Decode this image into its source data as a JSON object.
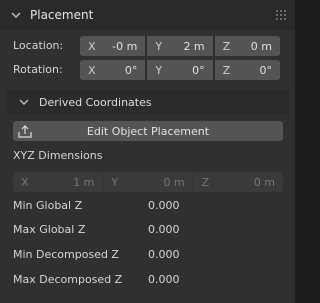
{
  "panel": {
    "title": "Placement"
  },
  "location": {
    "label": "Location:",
    "x_axis": "X",
    "x_value": "-0 m",
    "y_axis": "Y",
    "y_value": "2 m",
    "z_axis": "Z",
    "z_value": "0 m"
  },
  "rotation": {
    "label": "Rotation:",
    "x_axis": "X",
    "x_value": "0°",
    "y_axis": "Y",
    "y_value": "0°",
    "z_axis": "Z",
    "z_value": "0°"
  },
  "derived": {
    "title": "Derived Coordinates"
  },
  "edit_button": {
    "label": "Edit Object Placement"
  },
  "dimensions": {
    "label": "XYZ Dimensions",
    "x_axis": "X",
    "x_value": "1 m",
    "y_axis": "Y",
    "y_value": "0 m",
    "z_axis": "Z",
    "z_value": "0 m"
  },
  "properties": [
    {
      "label": "Min Global Z",
      "value": "0.000"
    },
    {
      "label": "Max Global Z",
      "value": "0.000"
    },
    {
      "label": "Min Decomposed Z",
      "value": "0.000"
    },
    {
      "label": "Max Decomposed Z",
      "value": "0.000"
    }
  ],
  "icons": {
    "panel_toggle": "chevron-down-icon",
    "drag_handle": "grip-icon",
    "sub_toggle": "chevron-down-icon",
    "edit": "upload-icon"
  }
}
